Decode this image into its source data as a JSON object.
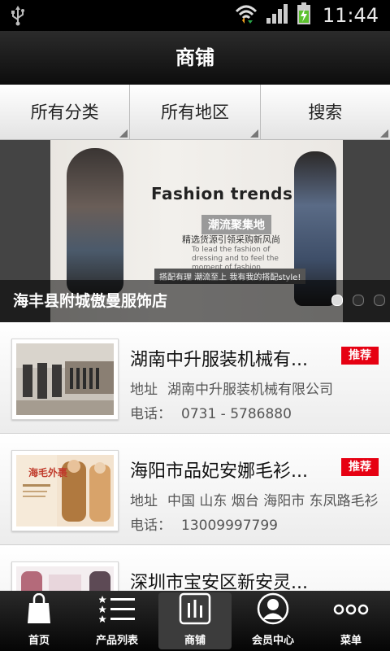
{
  "status_bar": {
    "time": "11:44"
  },
  "header": {
    "title": "商铺"
  },
  "filters": [
    {
      "label": "所有分类"
    },
    {
      "label": "所有地区"
    },
    {
      "label": "搜索"
    }
  ],
  "banner": {
    "ad_title": "Fashion trends",
    "ad_line1": "潮流聚集地",
    "ad_line2": "精选货源引领采购新风尚",
    "ad_line3": "To lead the fashion of dressing and to feel the moment of fashion",
    "ad_line4": "搭配有理 潮流至上 我有我的搭配style!",
    "caption": "海丰县附城傲曼服饰店",
    "slide_count": 3,
    "active_slide": 1
  },
  "listings": [
    {
      "name": "湖南中升服装机械有...",
      "badge": "推荐",
      "addr_label": "地址",
      "address": "湖南中升服装机械有限公司",
      "tel_label": "电话：",
      "phone": "0731 - 5786880"
    },
    {
      "name": "海阳市品妃安娜毛衫...",
      "badge": "推荐",
      "addr_label": "地址",
      "address": "中国 山东 烟台 海阳市 东凤路毛衫",
      "tel_label": "电话：",
      "phone": "13009997799",
      "thumb_text": "海毛外裹"
    },
    {
      "name": "深圳市宝安区新安灵..."
    }
  ],
  "nav": [
    {
      "label": "首页",
      "icon": "shopping-bag-icon"
    },
    {
      "label": "产品列表",
      "icon": "list-icon"
    },
    {
      "label": "商铺",
      "icon": "shop-icon",
      "active": true
    },
    {
      "label": "会员中心",
      "icon": "user-icon"
    },
    {
      "label": "菜单",
      "icon": "more-icon"
    }
  ],
  "colors": {
    "badge": "#e60012",
    "bar": "#000000"
  }
}
